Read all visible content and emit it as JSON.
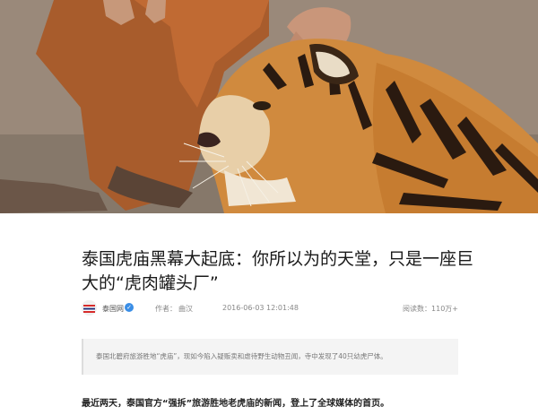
{
  "article": {
    "title": "泰国虎庙黑幕大起底：你所以为的天堂，只是一座巨大的“虎肉罐头厂”",
    "source_name": "泰国网",
    "author_label": "作者：",
    "author": "曲汉",
    "date": "2016-06-03 12:01:48",
    "reads": "阅读数：110万+",
    "summary": "泰国北碧府旅游胜地“虎庙”，现如今陷入疑贩卖和虐待野生动物丑闻，寺中发现了40只幼虎尸体。",
    "lead": "最近两天，泰国官方“强拆”旅游胜地老虎庙的新闻，登上了全球媒体的首页。"
  },
  "icons": {
    "verified": "verified-check-icon",
    "avatar": "flag-avatar-icon"
  }
}
